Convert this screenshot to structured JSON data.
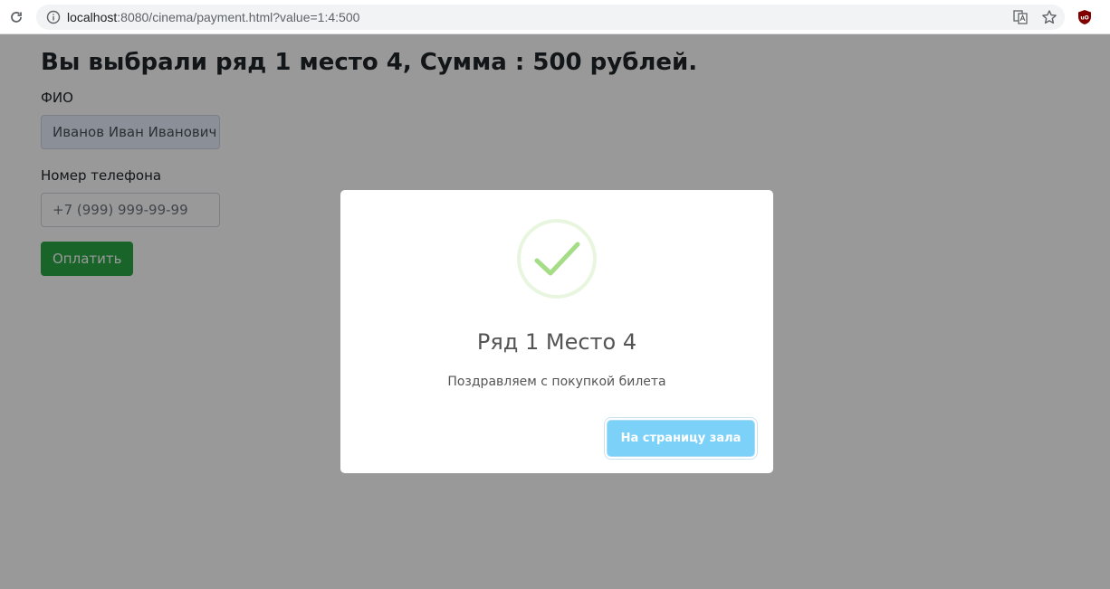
{
  "browser": {
    "url_host": "localhost",
    "url_path": ":8080/cinema/payment.html?value=1:4:500"
  },
  "page": {
    "heading": "Вы выбрали ряд 1 место 4, Сумма : 500 рублей.",
    "name_label": "ФИО",
    "name_value": "Иванов Иван Иванович",
    "phone_label": "Номер телефона",
    "phone_placeholder": "+7 (999) 999-99-99",
    "pay_button": "Оплатить"
  },
  "modal": {
    "icon": "success-check-icon",
    "title": "Ряд 1 Место 4",
    "text": "Поздравляем с покупкой билета",
    "button": "На страницу зала"
  },
  "colors": {
    "success_green": "#28a745",
    "check_green": "#a5dc86",
    "confirm_blue": "#7cd1f9"
  }
}
